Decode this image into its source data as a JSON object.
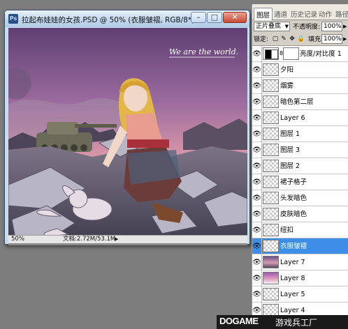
{
  "document": {
    "title": "拉起布娃娃的女孩.PSD @ 50% (衣服皱褶, RGB/8*)",
    "app_icon": "Ps",
    "window_buttons": [
      "minimize-icon",
      "maximize-icon",
      "close-icon"
    ],
    "zoom": "50%",
    "doc_info": "文档:2.72M/53.1M",
    "artwork_caption": "We are the world."
  },
  "panel": {
    "tabs": [
      "图层",
      "通道",
      "历史记录",
      "动作",
      "路径"
    ],
    "active_tab": "图层",
    "blend_mode": "正片叠底",
    "opacity_label": "不透明度:",
    "opacity_value": "100%",
    "lock_label": "锁定:",
    "fill_label": "填充:",
    "fill_value": "100%",
    "layers": [
      {
        "name": "亮度/对比度 1",
        "type": "adjustment",
        "visible": true
      },
      {
        "name": "夕阳",
        "type": "transparent",
        "visible": true
      },
      {
        "name": "烟雾",
        "type": "transparent",
        "visible": true
      },
      {
        "name": "暗色第二层",
        "type": "transparent",
        "visible": true
      },
      {
        "name": "Layer 6",
        "type": "transparent",
        "visible": true
      },
      {
        "name": "图层 1",
        "type": "transparent",
        "visible": true
      },
      {
        "name": "图层 3",
        "type": "transparent",
        "visible": true
      },
      {
        "name": "图层 2",
        "type": "transparent",
        "visible": true
      },
      {
        "name": "裙子格子",
        "type": "transparent",
        "visible": true
      },
      {
        "name": "头发暗色",
        "type": "transparent",
        "visible": true
      },
      {
        "name": "皮肤暗色",
        "type": "transparent",
        "visible": true
      },
      {
        "name": "纽扣",
        "type": "transparent",
        "visible": true
      },
      {
        "name": "衣服皱褶",
        "type": "transparent",
        "visible": true,
        "selected": true
      },
      {
        "name": "Layer 7",
        "type": "art",
        "visible": true
      },
      {
        "name": "Layer 8",
        "type": "art",
        "visible": true
      },
      {
        "name": "Layer 5",
        "type": "transparent",
        "visible": true
      },
      {
        "name": "Layer 4",
        "type": "transparent",
        "visible": true
      }
    ]
  },
  "banner": {
    "brand": "DOGAME",
    "brand_cn": "游戏兵工厂"
  },
  "colors": {
    "selected_layer": "#3d8ee8",
    "window_title_bg": "#c3d8ee",
    "close_button": "#c54a33"
  }
}
